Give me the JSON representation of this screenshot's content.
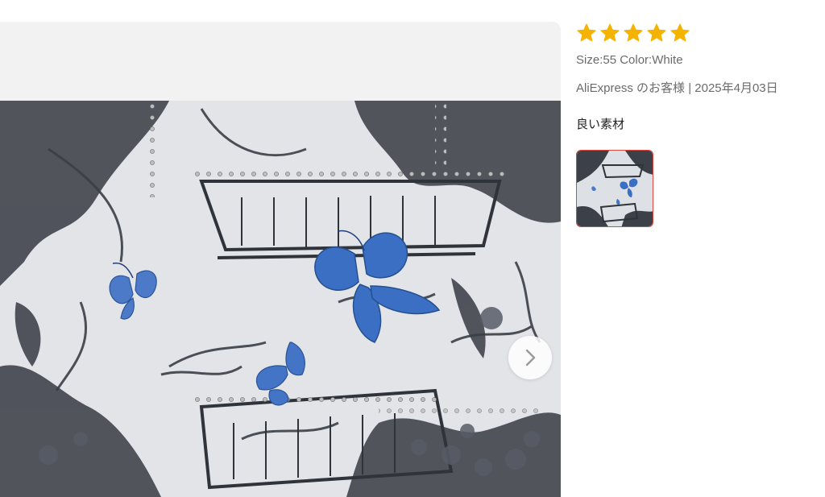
{
  "viewer": {
    "photo_icon": "embroidered-butterfly-fabric-photo",
    "next_icon": "chevron-right-icon"
  },
  "review": {
    "rating": 5,
    "rating_max": 5,
    "star_color": "#f5b301",
    "sku": "Size:55 Color:White",
    "meta": "AliExpress のお客様 | 2025年4月03日",
    "comment": "良い素材",
    "thumbnails": [
      {
        "icon": "review-photo-thumbnail",
        "selected": true,
        "selected_color": "#e0443a"
      }
    ]
  }
}
